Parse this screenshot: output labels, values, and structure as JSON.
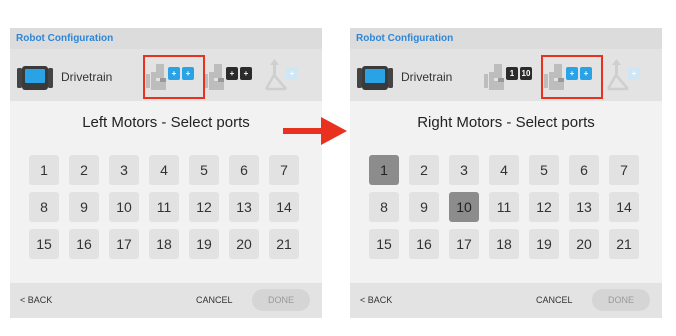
{
  "colors": {
    "accent_blue": "#2aa3e6",
    "title_blue": "#2f86d6",
    "highlight_red": "#e8311f",
    "selected_port": "#8c8c8c"
  },
  "left_screen": {
    "window_title": "Robot Configuration",
    "device_label": "Drivetrain",
    "slots": [
      {
        "name": "left-motors",
        "boxes": [
          "+",
          "+"
        ],
        "state": "active-blue",
        "highlighted": true
      },
      {
        "name": "right-motors",
        "boxes": [
          "+",
          "+"
        ],
        "state": "black"
      },
      {
        "name": "gyro",
        "boxes": [
          "+"
        ],
        "state": "faded"
      }
    ],
    "heading": "Left Motors - Select ports",
    "ports": [
      "1",
      "2",
      "3",
      "4",
      "5",
      "6",
      "7",
      "8",
      "9",
      "10",
      "11",
      "12",
      "13",
      "14",
      "15",
      "16",
      "17",
      "18",
      "19",
      "20",
      "21"
    ],
    "selected_ports": [],
    "footer": {
      "back": "< BACK",
      "cancel": "CANCEL",
      "done": "DONE"
    }
  },
  "right_screen": {
    "window_title": "Robot Configuration",
    "device_label": "Drivetrain",
    "slots": [
      {
        "name": "left-motors",
        "boxes": [
          "1",
          "10"
        ],
        "state": "black"
      },
      {
        "name": "right-motors",
        "boxes": [
          "+",
          "+"
        ],
        "state": "active-blue",
        "highlighted": true
      },
      {
        "name": "gyro",
        "boxes": [
          "+"
        ],
        "state": "faded"
      }
    ],
    "heading": "Right Motors - Select ports",
    "ports": [
      "1",
      "2",
      "3",
      "4",
      "5",
      "6",
      "7",
      "8",
      "9",
      "10",
      "11",
      "12",
      "13",
      "14",
      "15",
      "16",
      "17",
      "18",
      "19",
      "20",
      "21"
    ],
    "selected_ports": [
      "1",
      "10"
    ],
    "footer": {
      "back": "< BACK",
      "cancel": "CANCEL",
      "done": "DONE"
    }
  },
  "icons": {
    "drivetrain": "drivetrain-icon",
    "motor_group": "motor-group-icon",
    "gyro": "gyro-icon",
    "arrow": "right-arrow-icon"
  }
}
